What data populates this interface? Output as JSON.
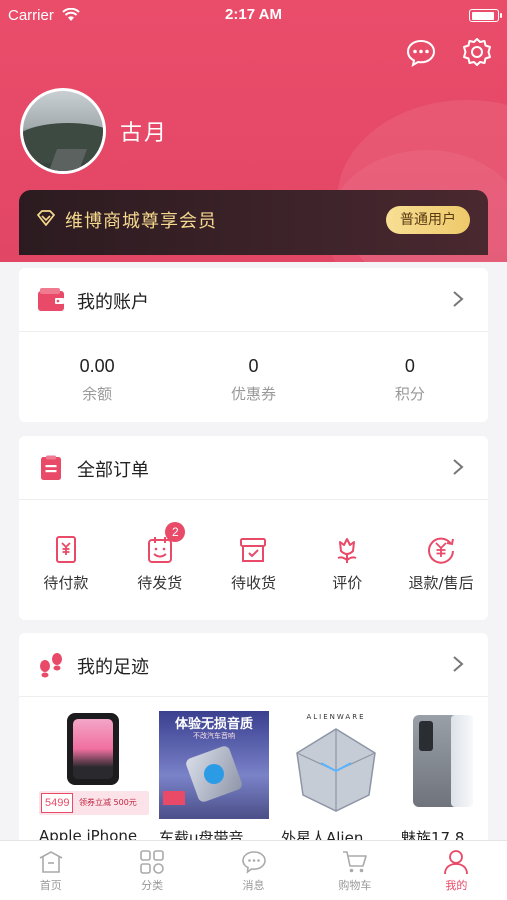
{
  "status_bar": {
    "carrier": "Carrier",
    "time": "2:17 AM",
    "battery_level": 0.95
  },
  "profile": {
    "username": "古月"
  },
  "vip": {
    "text": "维博商城尊享会员",
    "badge": "普通用户"
  },
  "account": {
    "title": "我的账户",
    "stats": [
      {
        "value": "0.00",
        "label": "余额"
      },
      {
        "value": "0",
        "label": "优惠券"
      },
      {
        "value": "0",
        "label": "积分"
      }
    ]
  },
  "orders": {
    "title": "全部订单",
    "items": [
      {
        "label": "待付款",
        "icon": "payment-icon"
      },
      {
        "label": "待发货",
        "icon": "calendar-icon",
        "badge": "2"
      },
      {
        "label": "待收货",
        "icon": "box-icon"
      },
      {
        "label": "评价",
        "icon": "flower-icon"
      },
      {
        "label": "退款/售后",
        "icon": "refund-icon"
      }
    ]
  },
  "footprint": {
    "title": "我的足迹",
    "products": [
      {
        "name": "Apple iPhone",
        "price_tag": "5499",
        "promo": "领券立减 500元"
      },
      {
        "name": "车载u盘带音",
        "banner": "体验无损音质",
        "banner_sub": "不改汽车音响"
      },
      {
        "name": "外星人Alien",
        "brand": "ALIENWARE"
      },
      {
        "name": "魅族17 8"
      }
    ]
  },
  "tabbar": [
    {
      "label": "首页",
      "icon": "home-icon",
      "active": false
    },
    {
      "label": "分类",
      "icon": "category-icon",
      "active": false
    },
    {
      "label": "消息",
      "icon": "message-icon",
      "active": false
    },
    {
      "label": "购物车",
      "icon": "cart-icon",
      "active": false
    },
    {
      "label": "我的",
      "icon": "profile-icon",
      "active": true
    }
  ],
  "colors": {
    "primary": "#e84a68",
    "vip_gold": "#f5d88e",
    "vip_bg": "#2b1b20"
  }
}
